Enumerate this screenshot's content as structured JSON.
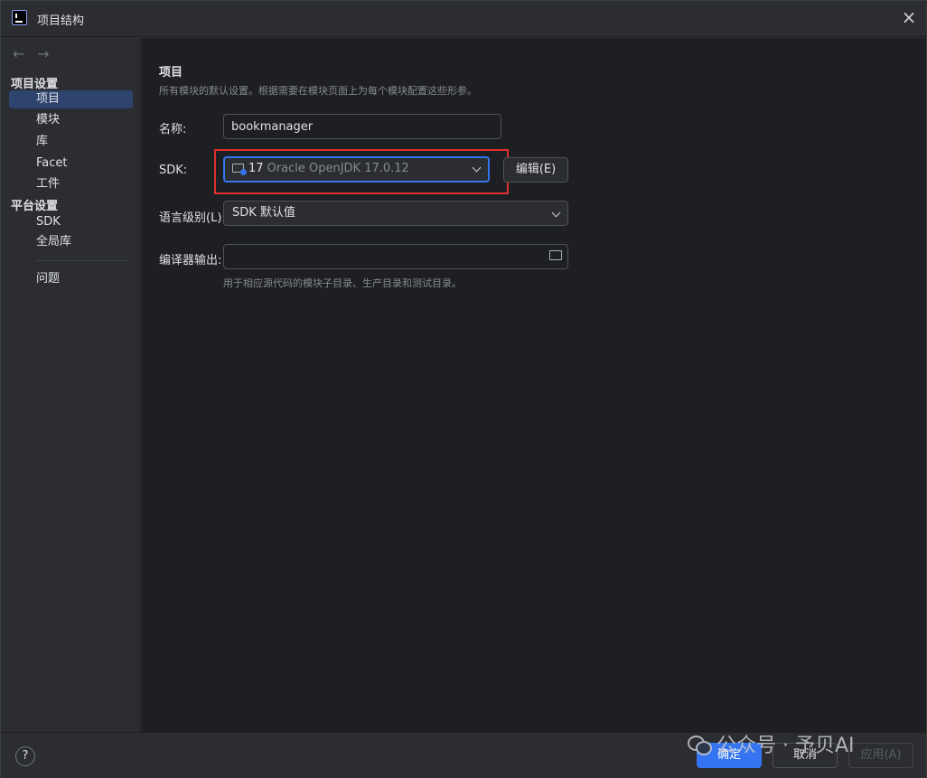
{
  "window": {
    "title": "项目结构"
  },
  "sidebar": {
    "nav_back": "←",
    "nav_forward": "→",
    "section_project": "项目设置",
    "project_items": [
      {
        "label": "项目"
      },
      {
        "label": "模块"
      },
      {
        "label": "库"
      },
      {
        "label": "Facet"
      },
      {
        "label": "工件"
      }
    ],
    "section_platform": "平台设置",
    "platform_items": [
      {
        "label": "SDK"
      },
      {
        "label": "全局库"
      }
    ],
    "problems": "问题"
  },
  "main": {
    "heading": "项目",
    "description": "所有模块的默认设置。根据需要在模块页面上为每个模块配置这些形参。",
    "name_label": "名称:",
    "name_value": "bookmanager",
    "sdk_label": "SDK:",
    "sdk_version": "17",
    "sdk_name": "Oracle OpenJDK 17.0.12",
    "edit_button": "编辑(E)",
    "language_level_label": "语言级别(L):",
    "language_level_value": "SDK 默认值",
    "compiler_output_label": "编译器输出:",
    "compiler_output_value": "",
    "compiler_output_hint": "用于相应源代码的模块子目录、生产目录和测试目录。"
  },
  "footer": {
    "help": "?",
    "ok": "确定",
    "cancel": "取消",
    "apply": "应用(A)"
  },
  "watermark": "公众号 · 予贝AI",
  "colors": {
    "accent": "#3574f0",
    "selection": "#2e436e",
    "highlight_box": "#e03130"
  }
}
